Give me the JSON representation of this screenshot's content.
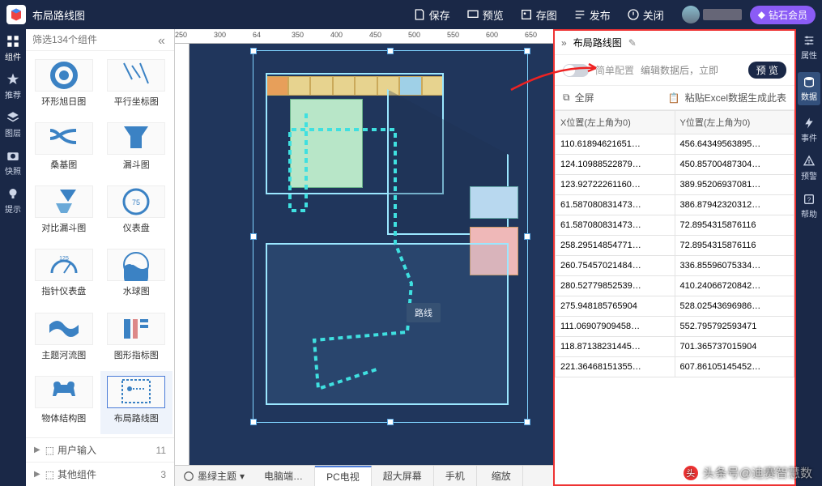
{
  "topbar": {
    "title": "布局路线图",
    "buttons": {
      "save": "保存",
      "preview": "预览",
      "saveimg": "存图",
      "publish": "发布",
      "close": "关闭"
    },
    "vip": "钻石会员"
  },
  "leftRail": [
    {
      "icon": "grid",
      "label": "组件"
    },
    {
      "icon": "star",
      "label": "推荐"
    },
    {
      "icon": "layers",
      "label": "图层"
    },
    {
      "icon": "camera",
      "label": "快照"
    },
    {
      "icon": "bulb",
      "label": "提示"
    }
  ],
  "panel": {
    "searchPlaceholder": "筛选134个组件",
    "cards": [
      {
        "name": "环形旭日图",
        "icon": "sunburst"
      },
      {
        "name": "平行坐标图",
        "icon": "parallel"
      },
      {
        "name": "桑基图",
        "icon": "sankey"
      },
      {
        "name": "漏斗图",
        "icon": "funnel"
      },
      {
        "name": "对比漏斗图",
        "icon": "funnel2"
      },
      {
        "name": "仪表盘",
        "icon": "gauge"
      },
      {
        "name": "指针仪表盘",
        "icon": "gauge2"
      },
      {
        "name": "水球图",
        "icon": "liquid"
      },
      {
        "name": "主题河流图",
        "icon": "river"
      },
      {
        "name": "图形指标图",
        "icon": "pictograph"
      },
      {
        "name": "物体结构图",
        "icon": "cow"
      },
      {
        "name": "布局路线图",
        "icon": "routemap",
        "selected": true
      }
    ],
    "footer": [
      {
        "label": "用户输入",
        "count": "11"
      },
      {
        "label": "其他组件",
        "count": "3"
      }
    ]
  },
  "ruler": {
    "marks": [
      "250",
      "300",
      "64",
      "350",
      "400",
      "450",
      "500",
      "550",
      "600",
      "650"
    ]
  },
  "canvas": {
    "tooltip": "路线"
  },
  "bottomTabs": {
    "themeLabel": "墨绿主题",
    "tabs": [
      {
        "label": "电脑端…"
      },
      {
        "label": "PC电视",
        "active": true
      },
      {
        "label": "超大屏幕"
      },
      {
        "label": "手机"
      }
    ],
    "zoom": "缩放"
  },
  "rightPanel": {
    "title": "布局路线图",
    "simpleConfig": "简单配置",
    "editHint": "编辑数据后，立即",
    "previewBtn": "预 览",
    "fullscreen": "全屏",
    "pasteExcel": "粘贴Excel数据生成此表",
    "cols": [
      "X位置(左上角为0)",
      "Y位置(左上角为0)"
    ],
    "rows": [
      [
        "110.61894621651…",
        "456.64349563895…"
      ],
      [
        "124.10988522879…",
        "450.85700487304…"
      ],
      [
        "123.92722261160…",
        "389.95206937081…"
      ],
      [
        "61.587080831473…",
        "386.87942320312…"
      ],
      [
        "61.587080831473…",
        "72.8954315876116"
      ],
      [
        "258.29514854771…",
        "72.8954315876116"
      ],
      [
        "260.75457021484…",
        "336.85596075334…"
      ],
      [
        "280.52779852539…",
        "410.24066720842…"
      ],
      [
        "275.948185765904",
        "528.02543696986…"
      ],
      [
        "111.06907909458…",
        "552.795792593471"
      ],
      [
        "118.87138231445…",
        "701.365737015904"
      ],
      [
        "221.36468151355…",
        "607.86105145452…"
      ]
    ]
  },
  "rightRail": [
    {
      "icon": "sliders",
      "label": "属性"
    },
    {
      "icon": "db",
      "label": "数据",
      "active": true
    },
    {
      "icon": "bolt",
      "label": "事件"
    },
    {
      "icon": "alert",
      "label": "预警"
    },
    {
      "icon": "help",
      "label": "帮助"
    }
  ],
  "watermark": "头条号@迪赛智慧数"
}
